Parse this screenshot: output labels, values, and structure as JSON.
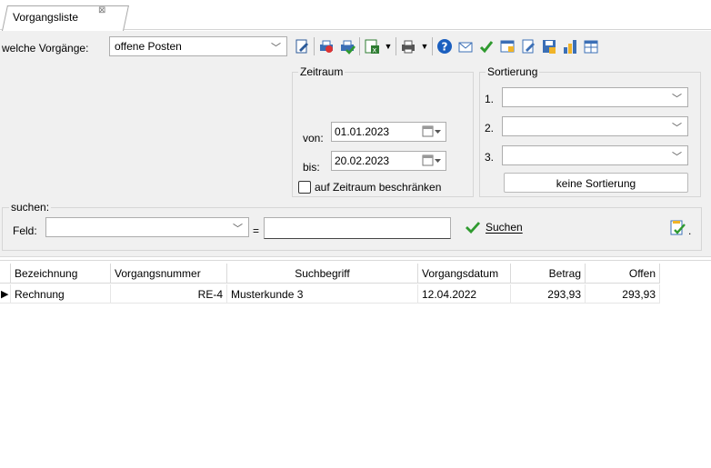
{
  "tab": {
    "title": "Vorgangsliste",
    "close_glyph": "⊠"
  },
  "toolbar": {
    "vorgaenge_label": "welche Vorgänge:",
    "vorgaenge_value": "offene Posten",
    "icons": [
      "edit-doc-icon",
      "print-preview-icon",
      "print-check-icon",
      "export-excel-icon",
      "printer-icon",
      "help-icon",
      "mail-icon",
      "check-icon",
      "table-icon",
      "edit-icon",
      "save-icon",
      "chart-icon",
      "calendar-icon"
    ]
  },
  "zeitraum": {
    "title": "Zeitraum",
    "von_label": "von:",
    "von_value": "01.01.2023",
    "bis_label": "bis:",
    "bis_value": "20.02.2023",
    "restrict_label": "auf Zeitraum beschränken",
    "restrict_checked": false
  },
  "sortierung": {
    "title": "Sortierung",
    "rows": [
      {
        "label": "1.",
        "value": ""
      },
      {
        "label": "2.",
        "value": ""
      },
      {
        "label": "3.",
        "value": ""
      }
    ],
    "reset_label": "keine Sortierung"
  },
  "suchen": {
    "title": "suchen:",
    "feld_label": "Feld:",
    "feld_value": "",
    "equals": "=",
    "search_value": "",
    "button_label": "Suchen",
    "button_accent": "#2f9a2f",
    "dot": "."
  },
  "grid": {
    "columns": [
      "Bezeichnung",
      "Vorgangsnummer",
      "Suchbegriff",
      "Vorgangsdatum",
      "Betrag",
      "Offen"
    ],
    "rows": [
      {
        "indicator": "▶",
        "cells": [
          "Rechnung",
          "RE-4",
          "Musterkunde 3",
          "12.04.2022",
          "293,93",
          "293,93"
        ]
      }
    ]
  }
}
